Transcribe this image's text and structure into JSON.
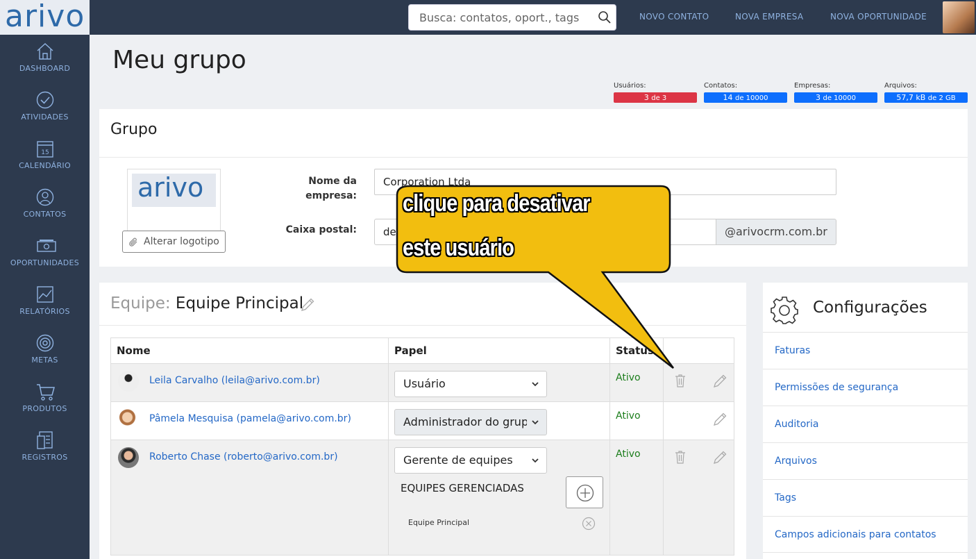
{
  "app": {
    "logo_text": "arivo"
  },
  "topbar": {
    "search_placeholder": "Busca: contatos, oport., tags",
    "links": [
      "NOVO CONTATO",
      "NOVA EMPRESA",
      "NOVA OPORTUNIDADE"
    ]
  },
  "sidebar": {
    "items": [
      {
        "label": "DASHBOARD",
        "icon": "home-icon"
      },
      {
        "label": "ATIVIDADES",
        "icon": "check-circle-icon"
      },
      {
        "label": "CALENDÁRIO",
        "icon": "calendar-icon",
        "day": "15"
      },
      {
        "label": "CONTATOS",
        "icon": "person-icon"
      },
      {
        "label": "OPORTUNIDADES",
        "icon": "money-icon"
      },
      {
        "label": "RELATÓRIOS",
        "icon": "chart-icon"
      },
      {
        "label": "METAS",
        "icon": "target-icon"
      },
      {
        "label": "PRODUTOS",
        "icon": "cart-icon"
      },
      {
        "label": "REGISTROS",
        "icon": "records-icon"
      }
    ]
  },
  "page": {
    "title": "Meu grupo"
  },
  "stats": [
    {
      "label": "Usuários:",
      "value": "3",
      "suffix": "de 3",
      "color": "#dc3545"
    },
    {
      "label": "Contatos:",
      "value": "14",
      "suffix": "de 10000",
      "color": "#0d6efd"
    },
    {
      "label": "Empresas:",
      "value": "3",
      "suffix": "de 10000",
      "color": "#0d6efd"
    },
    {
      "label": "Arquivos:",
      "value": "57,7 kB",
      "suffix": "de 2 GB",
      "color": "#0d6efd"
    }
  ],
  "group": {
    "title": "Grupo",
    "logo_text": "arivo",
    "change_logo_label": "Alterar logotipo",
    "company_label_1": "Nome da",
    "company_label_2": "empresa:",
    "company_value": "Corporation Ltda",
    "mailbox_label": "Caixa postal:",
    "mailbox_value": "de",
    "mailbox_suffix": "@arivocrm.com.br"
  },
  "team": {
    "prefix": "Equipe:",
    "name": "Equipe Principal",
    "columns": [
      "Nome",
      "Papel",
      "Status",
      ""
    ],
    "rows": [
      {
        "name": "Leila Carvalho (leila@arivo.com.br)",
        "role": "Usuário",
        "status": "Ativo",
        "deletable": true
      },
      {
        "name": "Pâmela Mesquisa (pamela@arivo.com.br)",
        "role": "Administrador do grupo",
        "status": "Ativo",
        "deletable": false
      },
      {
        "name": "Roberto Chase (roberto@arivo.com.br)",
        "role": "Gerente de equipes",
        "status": "Ativo",
        "deletable": true
      }
    ],
    "managed_label": "EQUIPES GERENCIADAS",
    "managed_team": "Equipe Principal"
  },
  "config": {
    "title": "Configurações",
    "items": [
      "Faturas",
      "Permissões de segurança",
      "Auditoria",
      "Arquivos",
      "Tags",
      "Campos adicionais para contatos"
    ]
  },
  "callout": {
    "line1": "clique para desativar",
    "line2": "este usuário",
    "color": "#f2be0f"
  }
}
